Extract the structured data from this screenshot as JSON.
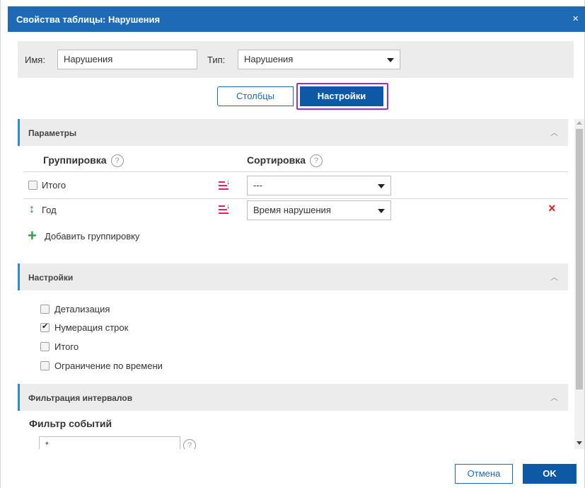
{
  "dialog": {
    "title": "Свойства таблицы: Нарушения",
    "close_glyph": "×"
  },
  "name_row": {
    "name_label": "Имя:",
    "name_value": "Нарушения",
    "type_label": "Тип:",
    "type_value": "Нарушения"
  },
  "tabs": {
    "columns": "Столбцы",
    "settings": "Настройки",
    "active": "settings"
  },
  "params_section": {
    "title": "Параметры",
    "grouping_header": "Группировка",
    "sorting_header": "Сортировка",
    "help_glyph": "?",
    "rows": [
      {
        "label": "Итого",
        "checked": false,
        "sort": "---",
        "deletable": false
      },
      {
        "label": "Год",
        "checked": null,
        "sort": "Время нарушения",
        "deletable": true
      }
    ],
    "add_grouping": "Добавить группировку",
    "plus_glyph": "+",
    "delete_glyph": "×"
  },
  "settings_section": {
    "title": "Настройки",
    "options": [
      {
        "label": "Детализация",
        "checked": false
      },
      {
        "label": "Нумерация строк",
        "checked": true
      },
      {
        "label": "Итого",
        "checked": false
      },
      {
        "label": "Ограничение по времени",
        "checked": false
      }
    ]
  },
  "filter_section": {
    "title": "Фильтрация интервалов",
    "event_filter_label": "Фильтр событий",
    "event_filter_value": "*"
  },
  "footer": {
    "cancel": "Отмена",
    "ok": "OK"
  },
  "colors": {
    "title_bar": "#1f6ab5",
    "primary_button": "#0d59a5",
    "section_accent": "#2b8ae0",
    "tab_highlight": "#9b30d9",
    "delete_red": "#e02020",
    "add_green": "#2ea043",
    "sort_icon": "#e0245e"
  },
  "icons": {
    "chevron": "chevron-up-icon",
    "sort": "sort-descending-icon",
    "drag": "vertical-arrows-icon",
    "help": "question-circle-icon",
    "add": "plus-icon",
    "delete": "close-x-icon"
  }
}
